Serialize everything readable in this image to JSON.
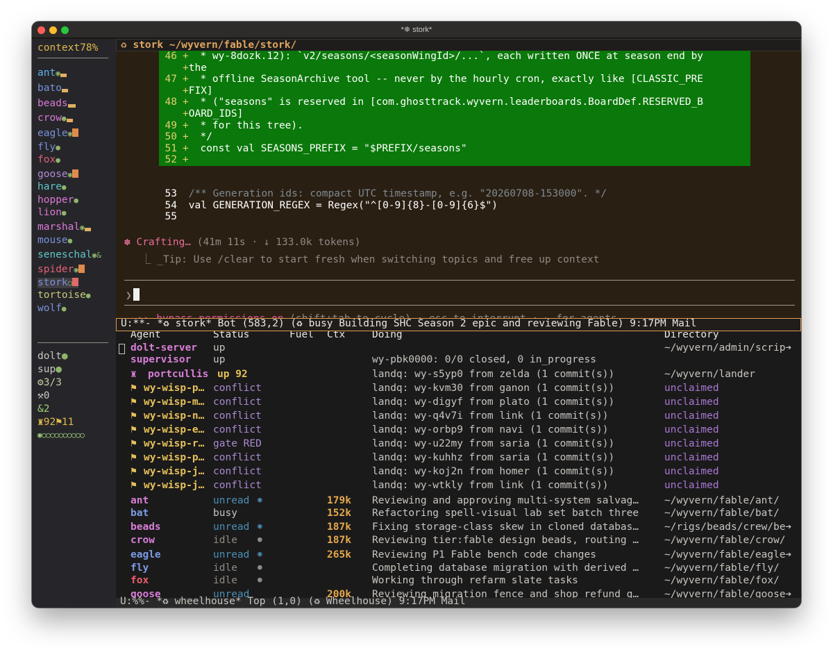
{
  "window": {
    "title": "*❄ stork*"
  },
  "sidebar": {
    "context_label": "context",
    "context_pct": "78%",
    "agents": [
      {
        "name": "ant",
        "color": "#5fb2e8",
        "mark": "◉"
      },
      {
        "name": "bato",
        "color": "#7a8fd8",
        "mark": ""
      },
      {
        "name": "beads",
        "color": "#d97ad3",
        "mark": ""
      },
      {
        "name": "crow",
        "color": "#d97ad3",
        "mark": "●"
      },
      {
        "name": "eagle",
        "color": "#7a8fd8",
        "mark": "◉"
      },
      {
        "name": "fly",
        "color": "#7a8fd8",
        "mark": "●"
      },
      {
        "name": "fox",
        "color": "#e0607a",
        "mark": "●"
      },
      {
        "name": "goose",
        "color": "#b48ad8",
        "mark": "◉"
      },
      {
        "name": "hare",
        "color": "#5fc7c7",
        "mark": "●"
      },
      {
        "name": "hopper",
        "color": "#d97ad3",
        "mark": "●"
      },
      {
        "name": "lion",
        "color": "#d97ad3",
        "mark": "●"
      },
      {
        "name": "marshal",
        "color": "#d97ad3",
        "mark": "◉"
      },
      {
        "name": "mouse",
        "color": "#7a8fd8",
        "mark": "●"
      },
      {
        "name": "seneschal",
        "color": "#5fc7c7",
        "mark": "◉&"
      },
      {
        "name": "spider",
        "color": "#e0607a",
        "mark": "◉"
      },
      {
        "name": "stork",
        "color": "#7a8fd8",
        "mark": "○"
      },
      {
        "name": "tortoise",
        "color": "#c8c87a",
        "mark": "●"
      },
      {
        "name": "wolf",
        "color": "#7a8fd8",
        "mark": "●"
      }
    ],
    "services": [
      {
        "name": "dolt",
        "mark": "●"
      },
      {
        "name": "sup",
        "mark": "●"
      }
    ],
    "stats": [
      "⚙3/3",
      "⚒0",
      "&2",
      "♜92⚑11",
      "◉○○○○○○○○○○"
    ]
  },
  "session": {
    "header": "stork ~/wyvern/fable/stork/",
    "diff_lines": [
      {
        "n": "46",
        "sign": "+",
        "text": "    * wy-8dozk.12): `v2/seasons/<seasonWingId>/...`, each written ONCE at season end by"
      },
      {
        "n": "",
        "sign": "+",
        "text": "the"
      },
      {
        "n": "47",
        "sign": "+",
        "text": "    * offline SeasonArchive tool -- never by the hourly cron, exactly like [CLASSIC_PRE"
      },
      {
        "n": "",
        "sign": "+",
        "text": "FIX]"
      },
      {
        "n": "48",
        "sign": "+",
        "text": "    * (\"seasons\" is reserved in [com.ghosttrack.wyvern.leaderboards.BoardDef.RESERVED_B"
      },
      {
        "n": "",
        "sign": "+",
        "text": "OARD_IDS]"
      },
      {
        "n": "49",
        "sign": "+",
        "text": "    * for this tree)."
      },
      {
        "n": "50",
        "sign": "+",
        "text": "    */"
      },
      {
        "n": "51",
        "sign": "+",
        "text": "   const val SEASONS_PREFIX = \"$PREFIX/seasons\""
      },
      {
        "n": "52",
        "sign": "+",
        "text": ""
      }
    ],
    "ctx_lines": [
      {
        "n": "53",
        "text": "   /** Generation ids: compact UTC timestamp, e.g. \"20260708-153000\". */"
      },
      {
        "n": "54",
        "text": "   val GENERATION_REGEX = Regex(\"^[0-9]{8}-[0-9]{6}$\")"
      },
      {
        "n": "55",
        "text": ""
      }
    ],
    "crafting": "✽ Crafting…",
    "crafting_meta": "(41m 11s · ↓ 133.0k tokens)",
    "tip": "⎿ _Tip: Use /clear to start fresh when switching topics and free up context",
    "prompt": "❯",
    "bypass_icon": "▸▸",
    "bypass": "bypass permissions on",
    "bypass_hint": "(shift+tab to cycle) · esc to interrupt · ← for agents"
  },
  "modeline_top": "U:**-  *♻ stork*    Bot   (583,2)    (♻ busy Building SHC Season 2 epic and reviewing Fable) 9:17PM Mail",
  "table": {
    "columns": [
      "Agent",
      "Status",
      "Fuel",
      "Ctx",
      "Doing",
      "Directory"
    ],
    "services": [
      {
        "agent": "dolt-server",
        "status": "up",
        "doing": "",
        "dir": "~/wyvern/admin/scrip➔"
      },
      {
        "agent": "supervisor",
        "status": "up",
        "doing": "wy-pbk0000: 0/0 closed, 0 in_progress",
        "dir": ""
      }
    ],
    "portcullis": {
      "icon": "♜",
      "agent": "portcullis",
      "status": "up 92",
      "doing": "landq: wy-s5yp0 from zelda (1 commit(s))",
      "dir": "~/wyvern/lander"
    },
    "wisps": [
      {
        "agent": "wy-wisp-p…",
        "status": "conflict",
        "doing": "landq: wy-kvm30 from ganon (1 commit(s))",
        "dir": "unclaimed"
      },
      {
        "agent": "wy-wisp-m…",
        "status": "conflict",
        "doing": "landq: wy-digyf from plato (1 commit(s))",
        "dir": "unclaimed"
      },
      {
        "agent": "wy-wisp-n…",
        "status": "conflict",
        "doing": "landq: wy-q4v7i from link (1 commit(s))",
        "dir": "unclaimed"
      },
      {
        "agent": "wy-wisp-e…",
        "status": "conflict",
        "doing": "landq: wy-orbp9 from navi (1 commit(s))",
        "dir": "unclaimed"
      },
      {
        "agent": "wy-wisp-r…",
        "status": "gate RED",
        "doing": "landq: wy-u22my from saria (1 commit(s))",
        "dir": "unclaimed"
      },
      {
        "agent": "wy-wisp-p…",
        "status": "conflict",
        "doing": "landq: wy-kuhhz from saria (1 commit(s))",
        "dir": "unclaimed"
      },
      {
        "agent": "wy-wisp-j…",
        "status": "conflict",
        "doing": "landq: wy-koj2n from homer (1 commit(s))",
        "dir": "unclaimed"
      },
      {
        "agent": "wy-wisp-j…",
        "status": "conflict",
        "doing": "landq: wy-wtkly from link (1 commit(s))",
        "dir": "unclaimed"
      }
    ],
    "workers": [
      {
        "agent": "ant",
        "color": "#d77fd8",
        "status": "unread",
        "mark": "◉",
        "ctx": "179k",
        "doing": "Reviewing and approving multi-system salvag…",
        "dir": "~/wyvern/fable/ant/"
      },
      {
        "agent": "bat",
        "color": "#7a9be6",
        "status": "busy",
        "mark": "",
        "ctx": "152k",
        "doing": "Refactoring spell-visual lab set batch three",
        "dir": "~/wyvern/fable/bat/"
      },
      {
        "agent": "beads",
        "color": "#d77fd8",
        "status": "unread",
        "mark": "◉",
        "ctx": "187k",
        "doing": "Fixing storage-class skew in cloned databas…",
        "dir": "~/rigs/beads/crew/be➔"
      },
      {
        "agent": "crow",
        "color": "#d77fd8",
        "status": "idle",
        "mark": "●",
        "ctx": "187k",
        "doing": "Reviewing tier:fable design beads, routing …",
        "dir": "~/wyvern/fable/crow/"
      },
      {
        "agent": "eagle",
        "color": "#7a9be6",
        "status": "unread",
        "mark": "◉",
        "ctx": "265k",
        "doing": "Reviewing P1 Fable bench code changes",
        "dir": "~/wyvern/fable/eagle➔"
      },
      {
        "agent": "fly",
        "color": "#7a9be6",
        "status": "idle",
        "mark": "●",
        "ctx": "",
        "doing": "Completing database migration with derived …",
        "dir": "~/wyvern/fable/fly/"
      },
      {
        "agent": "fox",
        "color": "#ef5b6b",
        "status": "idle",
        "mark": "●",
        "ctx": "",
        "doing": "Working through refarm slate tasks",
        "dir": "~/wyvern/fable/fox/"
      },
      {
        "agent": "goose",
        "color": "#d77fd8",
        "status": "unread",
        "mark": "",
        "ctx": "200k",
        "doing": "Reviewing migration fence and shop refund q…",
        "dir": "~/wyvern/fable/goose➔"
      }
    ]
  },
  "modeline_bottom": "U:%%-  *♻ wheelhouse*   Top   (1,0)      (♻ Wheelhouse) 9:17PM Mail"
}
